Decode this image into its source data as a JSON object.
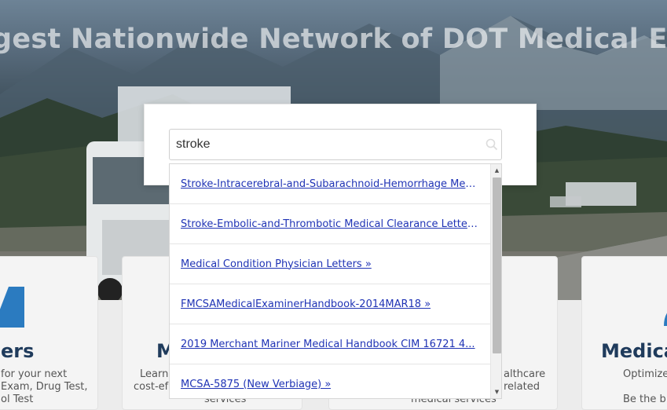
{
  "hero": {
    "title": "gest Nationwide Network of DOT Medical Exami"
  },
  "cards": [
    {
      "title": "ers",
      "lines": [
        "for your next",
        "Exam, Drug Test,",
        "ol Test"
      ]
    },
    {
      "title": "M",
      "lines": [
        "Learn",
        "cost-ef",
        "services"
      ]
    },
    {
      "title": "",
      "lines": [
        "althcare",
        "related",
        "medical services"
      ]
    },
    {
      "title": "Medica",
      "lines": [
        "Optimize",
        "Be the b"
      ]
    }
  ],
  "search": {
    "value": "stroke",
    "icon": "search-icon"
  },
  "results": [
    "Stroke-Intracerebral-and-Subarachnoid-Hemorrhage Medical Clearance Letter »",
    "Stroke-Embolic-and-Thrombotic Medical Clearance Letter »",
    "Medical Condition Physician Letters »",
    "FMCSAMedicalExaminerHandbook-2014MAR18 »",
    "2019 Merchant Mariner Medical Handbook CIM 16721 4...",
    "MCSA-5875 (New Verbiage) »"
  ],
  "colors": {
    "link": "#1f33b5",
    "card_title": "#1f3b5c",
    "accent": "#2b7bc0"
  }
}
